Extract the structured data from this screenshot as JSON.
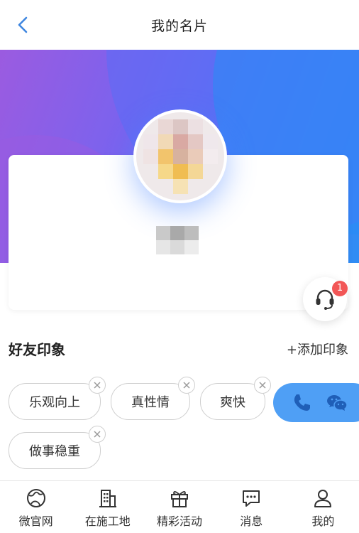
{
  "nav": {
    "title": "我的名片"
  },
  "colors": {
    "accent": "#4f9ff5",
    "badge": "#f25656",
    "back": "#3e86e0"
  },
  "support": {
    "badge_count": "1"
  },
  "impressions": {
    "title": "好友印象",
    "add_label": "+添加印象",
    "tags": [
      "乐观向上",
      "真性情",
      "爽快",
      "做事稳重"
    ]
  },
  "contact": {
    "phone_icon": "phone-icon",
    "wechat_icon": "wechat-icon"
  },
  "tabbar": {
    "items": [
      {
        "label": "微官网",
        "icon": "globe-icon"
      },
      {
        "label": "在施工地",
        "icon": "building-icon"
      },
      {
        "label": "精彩活动",
        "icon": "gift-icon"
      },
      {
        "label": "消息",
        "icon": "message-icon"
      },
      {
        "label": "我的",
        "icon": "user-icon"
      }
    ]
  }
}
